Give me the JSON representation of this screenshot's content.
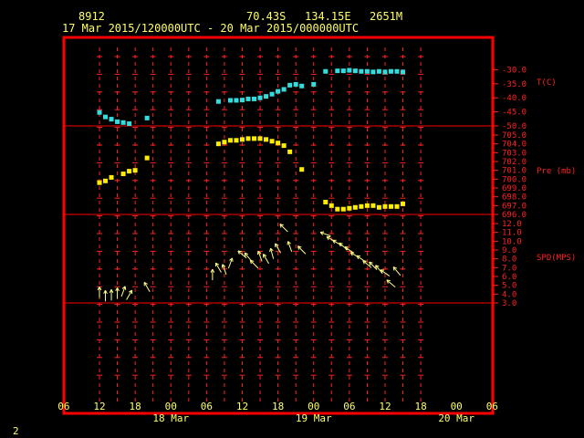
{
  "header": {
    "station": "8912",
    "lat": "70.43S",
    "lon": "134.15E",
    "elev": "2651M",
    "range": "17 Mar 2015/120000UTC - 20 Mar 2015/000000UTC"
  },
  "page_number": "2",
  "colors": {
    "frame": "#ff0000",
    "axis_text": "#ff2222",
    "time_text": "#ffff66",
    "temperature": "#33dddd",
    "pressure": "#ffee00",
    "wind": "#ffff88"
  },
  "chart_data": [
    {
      "type": "scatter",
      "ylabel": "T(C)",
      "ylim": [
        -50,
        -25
      ],
      "yticks": [
        "-30.0",
        "-35.0",
        "-40.0",
        "-45.0",
        "-50.0"
      ],
      "ytick_values": [
        -30,
        -35,
        -40,
        -45,
        -50
      ],
      "x": [
        0,
        1,
        2,
        3,
        4,
        5,
        8,
        20,
        22,
        23,
        24,
        25,
        26,
        27,
        28,
        29,
        30,
        31,
        32,
        33,
        34,
        36,
        38,
        40,
        41,
        42,
        43,
        44,
        45,
        46,
        47,
        48,
        49,
        50,
        51
      ],
      "values": [
        -45.2,
        -46.8,
        -47.6,
        -48.5,
        -48.8,
        -49.2,
        -47.2,
        -41.3,
        -40.9,
        -40.9,
        -40.8,
        -40.4,
        -40.4,
        -40.0,
        -39.5,
        -38.7,
        -37.7,
        -37.0,
        -35.5,
        -35.2,
        -35.8,
        -35.2,
        -30.6,
        -30.4,
        -30.4,
        -30.2,
        -30.4,
        -30.6,
        -30.6,
        -30.8,
        -30.6,
        -30.8,
        -30.6,
        -30.6,
        -30.8
      ]
    },
    {
      "type": "scatter",
      "ylabel": "Pre (mb)",
      "ylim": [
        696,
        705
      ],
      "yticks": [
        "705.0",
        "704.0",
        "703.0",
        "702.0",
        "701.0",
        "700.0",
        "699.0",
        "698.0",
        "697.0",
        "696.0"
      ],
      "ytick_values": [
        705,
        704,
        703,
        702,
        701,
        700,
        699,
        698,
        697,
        696
      ],
      "x": [
        0,
        1,
        2,
        4,
        5,
        6,
        8,
        20,
        21,
        22,
        23,
        24,
        25,
        26,
        27,
        28,
        29,
        30,
        31,
        32,
        34,
        38,
        39,
        40,
        41,
        42,
        43,
        44,
        45,
        46,
        47,
        48,
        49,
        50,
        51
      ],
      "values": [
        699.6,
        699.8,
        700.2,
        700.6,
        700.9,
        701.0,
        702.4,
        704.0,
        704.2,
        704.4,
        704.4,
        704.5,
        704.6,
        704.6,
        704.6,
        704.5,
        704.3,
        704.1,
        703.8,
        703.1,
        701.1,
        697.4,
        697.0,
        696.6,
        696.6,
        696.7,
        696.8,
        696.9,
        697.0,
        697.0,
        696.8,
        696.9,
        696.9,
        696.9,
        697.2
      ]
    },
    {
      "type": "scatter",
      "ylabel": "SPD(MPS)",
      "ylim": [
        3,
        12
      ],
      "yticks": [
        "12.0",
        "11.0",
        "10.0",
        "9.0",
        "8.0",
        "7.0",
        "6.0",
        "5.0",
        "4.0",
        "3.0"
      ],
      "ytick_values": [
        12,
        11,
        10,
        9,
        8,
        7,
        6,
        5,
        4,
        3
      ],
      "x": [
        0,
        1,
        2,
        3,
        4,
        5,
        8,
        19,
        20,
        21,
        22,
        24,
        25,
        26,
        27,
        28,
        29,
        30,
        31,
        32,
        34,
        38,
        39,
        40,
        41,
        42,
        43,
        44,
        45,
        46,
        47,
        48,
        49,
        50
      ],
      "values": [
        4.2,
        3.8,
        3.9,
        4.1,
        4.3,
        3.9,
        4.8,
        6.2,
        7.0,
        6.8,
        7.5,
        8.5,
        8.2,
        7.4,
        8.3,
        8.0,
        8.6,
        9.2,
        11.5,
        9.4,
        9.0,
        10.8,
        10.2,
        9.8,
        9.4,
        9.0,
        8.4,
        8.0,
        7.4,
        7.2,
        6.8,
        6.4,
        5.2,
        6.6
      ],
      "directions_deg": [
        180,
        180,
        180,
        180,
        200,
        210,
        150,
        180,
        150,
        160,
        200,
        130,
        140,
        135,
        160,
        150,
        165,
        150,
        135,
        160,
        135,
        110,
        120,
        120,
        130,
        125,
        120,
        125,
        130,
        135,
        140,
        125,
        130,
        140
      ]
    }
  ],
  "x_axis": {
    "start": "17 Mar 2015 12 UTC",
    "step_hours": 1,
    "hour_ticks": [
      "06",
      "12",
      "18",
      "00",
      "06",
      "12",
      "18",
      "00",
      "06",
      "12",
      "18",
      "00",
      "06"
    ],
    "hour_tick_positions": [
      -6,
      0,
      6,
      12,
      18,
      24,
      30,
      36,
      42,
      48,
      54,
      60,
      66
    ],
    "date_labels": [
      "18 Mar",
      "19 Mar",
      "20 Mar"
    ],
    "date_label_positions": [
      12,
      36,
      60
    ]
  }
}
